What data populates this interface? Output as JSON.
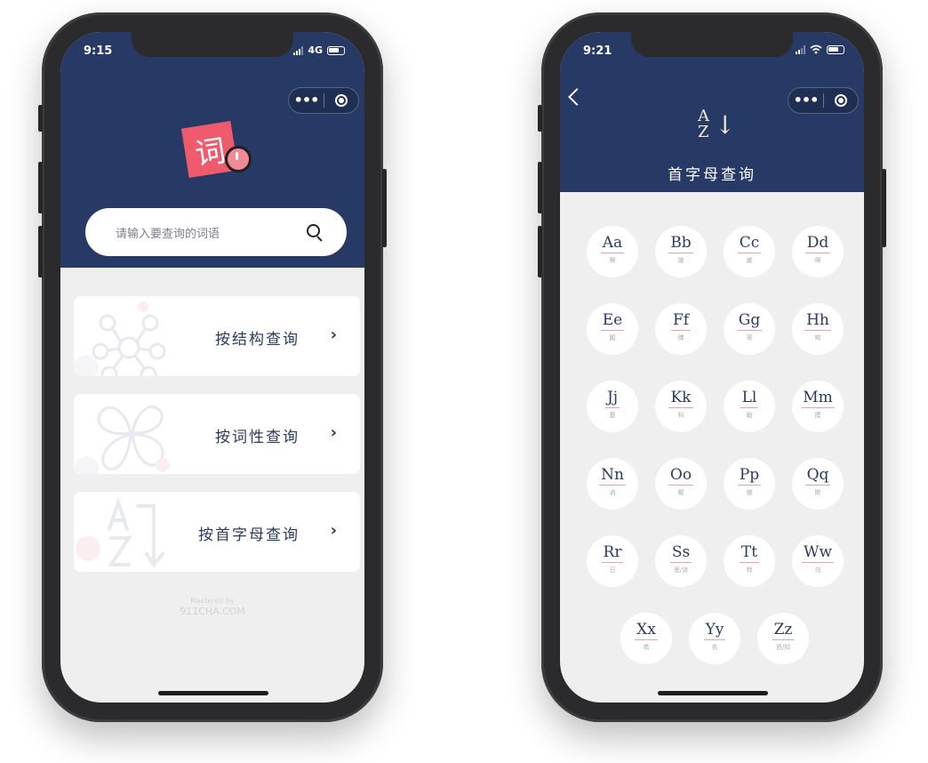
{
  "left_phone": {
    "status": {
      "time": "9:15",
      "network": "4G"
    },
    "logo_char": "词",
    "search": {
      "placeholder": "请输入要查询的词语"
    },
    "menu": [
      {
        "label": "按结构查询",
        "icon": "molecule-icon"
      },
      {
        "label": "按词性查询",
        "icon": "clover-icon"
      },
      {
        "label": "按首字母查询",
        "icon": "az-sort-icon"
      }
    ],
    "chevron": "›",
    "watermark": {
      "line1": "Mastered by",
      "line2": "911CHA.COM"
    }
  },
  "right_phone": {
    "status": {
      "time": "9:21"
    },
    "az_icon": {
      "top": "A",
      "bottom": "Z",
      "arrow": "↓"
    },
    "title": "首字母查询",
    "letters": [
      {
        "big": "Aa",
        "small": "啊"
      },
      {
        "big": "Bb",
        "small": "玻"
      },
      {
        "big": "Cc",
        "small": "雌"
      },
      {
        "big": "Dd",
        "small": "得"
      },
      {
        "big": "Ee",
        "small": "鹅"
      },
      {
        "big": "Ff",
        "small": "佛"
      },
      {
        "big": "Gg",
        "small": "哥"
      },
      {
        "big": "Hh",
        "small": "喝"
      },
      {
        "big": "Jj",
        "small": "基"
      },
      {
        "big": "Kk",
        "small": "科"
      },
      {
        "big": "Ll",
        "small": "勒"
      },
      {
        "big": "Mm",
        "small": "摸"
      },
      {
        "big": "Nn",
        "small": "讷"
      },
      {
        "big": "Oo",
        "small": "喔"
      },
      {
        "big": "Pp",
        "small": "坡"
      },
      {
        "big": "Qq",
        "small": "欺"
      },
      {
        "big": "Rr",
        "small": "日"
      },
      {
        "big": "Ss",
        "small": "思/诗"
      },
      {
        "big": "Tt",
        "small": "特"
      },
      {
        "big": "Ww",
        "small": "乌"
      },
      {
        "big": "Xx",
        "small": "希"
      },
      {
        "big": "Yy",
        "small": "衣"
      },
      {
        "big": "Zz",
        "small": "资/知"
      }
    ]
  },
  "colors": {
    "header_navy": "#273a66",
    "accent_pink": "#ef5b6c",
    "text_navy": "#2c3a5c",
    "screen_bg": "#efefef"
  }
}
